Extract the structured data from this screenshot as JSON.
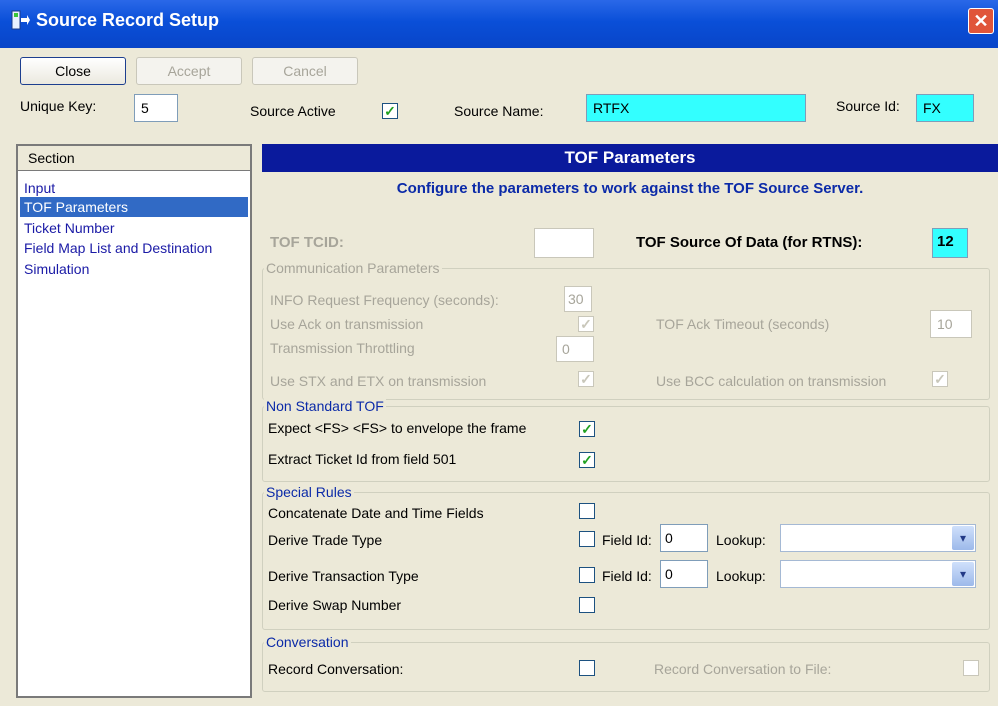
{
  "window": {
    "title": "Source Record Setup",
    "close_glyph": "✕"
  },
  "toolbar": {
    "close_label": "Close",
    "accept_label": "Accept",
    "cancel_label": "Cancel"
  },
  "header_fields": {
    "unique_key_label": "Unique Key:",
    "unique_key_value": "5",
    "source_active_label": "Source Active",
    "source_active_checked": true,
    "source_name_label": "Source Name:",
    "source_name_value": "RTFX",
    "source_id_label": "Source Id:",
    "source_id_value": "FX"
  },
  "sections": {
    "header": "Section",
    "items": [
      {
        "label": "Input",
        "selected": false
      },
      {
        "label": "TOF Parameters",
        "selected": true
      },
      {
        "label": "Ticket Number",
        "selected": false
      },
      {
        "label": "Field Map List and Destination",
        "selected": false
      },
      {
        "label": "Simulation",
        "selected": false
      }
    ]
  },
  "tof": {
    "header": "TOF Parameters",
    "subtitle": "Configure the parameters to work against the TOF Source Server.",
    "tcid_label": "TOF TCID:",
    "tcid_value": "",
    "source_of_data_label": "TOF Source Of Data (for RTNS):",
    "source_of_data_value": "12"
  },
  "communication": {
    "title": "Communication Parameters",
    "info_freq_label": "INFO Request Frequency (seconds):",
    "info_freq_value": "30",
    "use_ack_label": "Use Ack on transmission",
    "ack_timeout_label": "TOF Ack Timeout (seconds)",
    "ack_timeout_value": "10",
    "throttling_label": "Transmission Throttling",
    "throttling_value": "0",
    "use_stx_label": "Use STX and ETX on transmission",
    "use_bcc_label": "Use BCC calculation on transmission"
  },
  "non_standard": {
    "title": "Non Standard TOF",
    "expect_fs_label": "Expect <FS> <FS> to envelope the frame",
    "extract_ticket_label": "Extract Ticket Id from field 501"
  },
  "special_rules": {
    "title": "Special Rules",
    "concat_label": "Concatenate Date and Time Fields",
    "trade_type_label": "Derive Trade Type",
    "transaction_type_label": "Derive Transaction Type",
    "swap_label": "Derive Swap Number",
    "field_id_label": "Field Id:",
    "field_id_value_1": "0",
    "field_id_value_2": "0",
    "lookup_label": "Lookup:"
  },
  "conversation": {
    "title": "Conversation",
    "record_label": "Record Conversation:",
    "record_file_label": "Record Conversation to File:"
  },
  "glyphs": {
    "check": "✓",
    "chevron": "▾"
  },
  "icons": {
    "app": "app-window-icon",
    "close": "close-icon",
    "dropdown": "chevron-down-icon"
  }
}
